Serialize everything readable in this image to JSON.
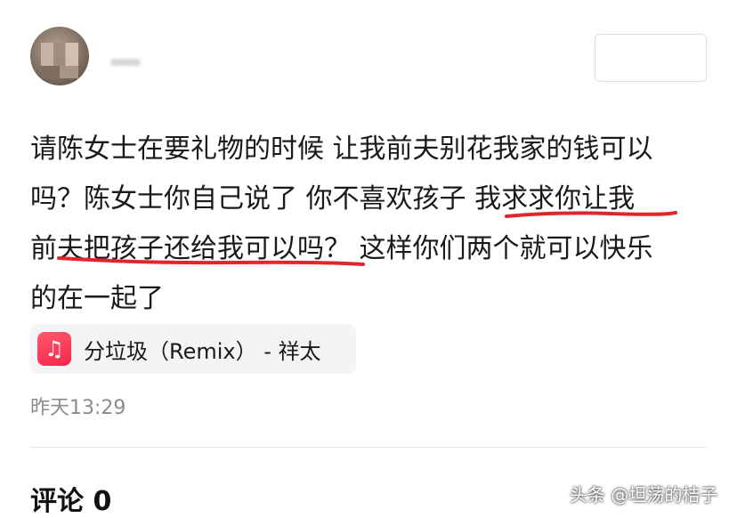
{
  "post": {
    "line1": "请陈女士在要礼物的时候 让我前夫别花我家的钱可以",
    "line2": "吗？陈女士你自己说了 你不喜欢孩子 我求求你让我",
    "line3": "前夫把孩子还给我可以吗？ 这样你们两个就可以快乐",
    "line4": "的在一起了"
  },
  "music_card": {
    "icon": "music-note-icon",
    "title": "分垃圾（Remix） - 祥太"
  },
  "timestamp": "昨天13:29",
  "comments": {
    "label": "评论 0"
  },
  "watermark": "头条 @坦荡的桔子",
  "colors": {
    "underline": "#e0262d",
    "music_icon": "#f5264a",
    "timestamp": "#8c8c8c"
  }
}
